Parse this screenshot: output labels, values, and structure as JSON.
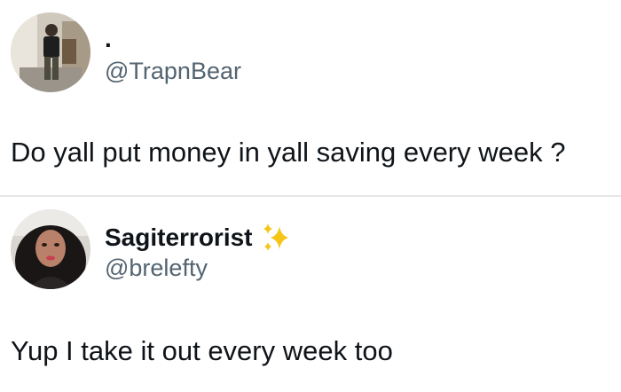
{
  "tweets": [
    {
      "display_name": ".",
      "handle": "@TrapnBear",
      "text": "Do yall put money in yall saving every week ?"
    },
    {
      "display_name": "Sagiterrorist",
      "handle": "@brelefty",
      "text": "Yup I take it out every week too",
      "name_icon": "sparkles-icon"
    }
  ],
  "colors": {
    "text": "#0f1419",
    "handle": "#536471",
    "divider": "#e6e6e6",
    "sparkle": "#f5c518"
  }
}
